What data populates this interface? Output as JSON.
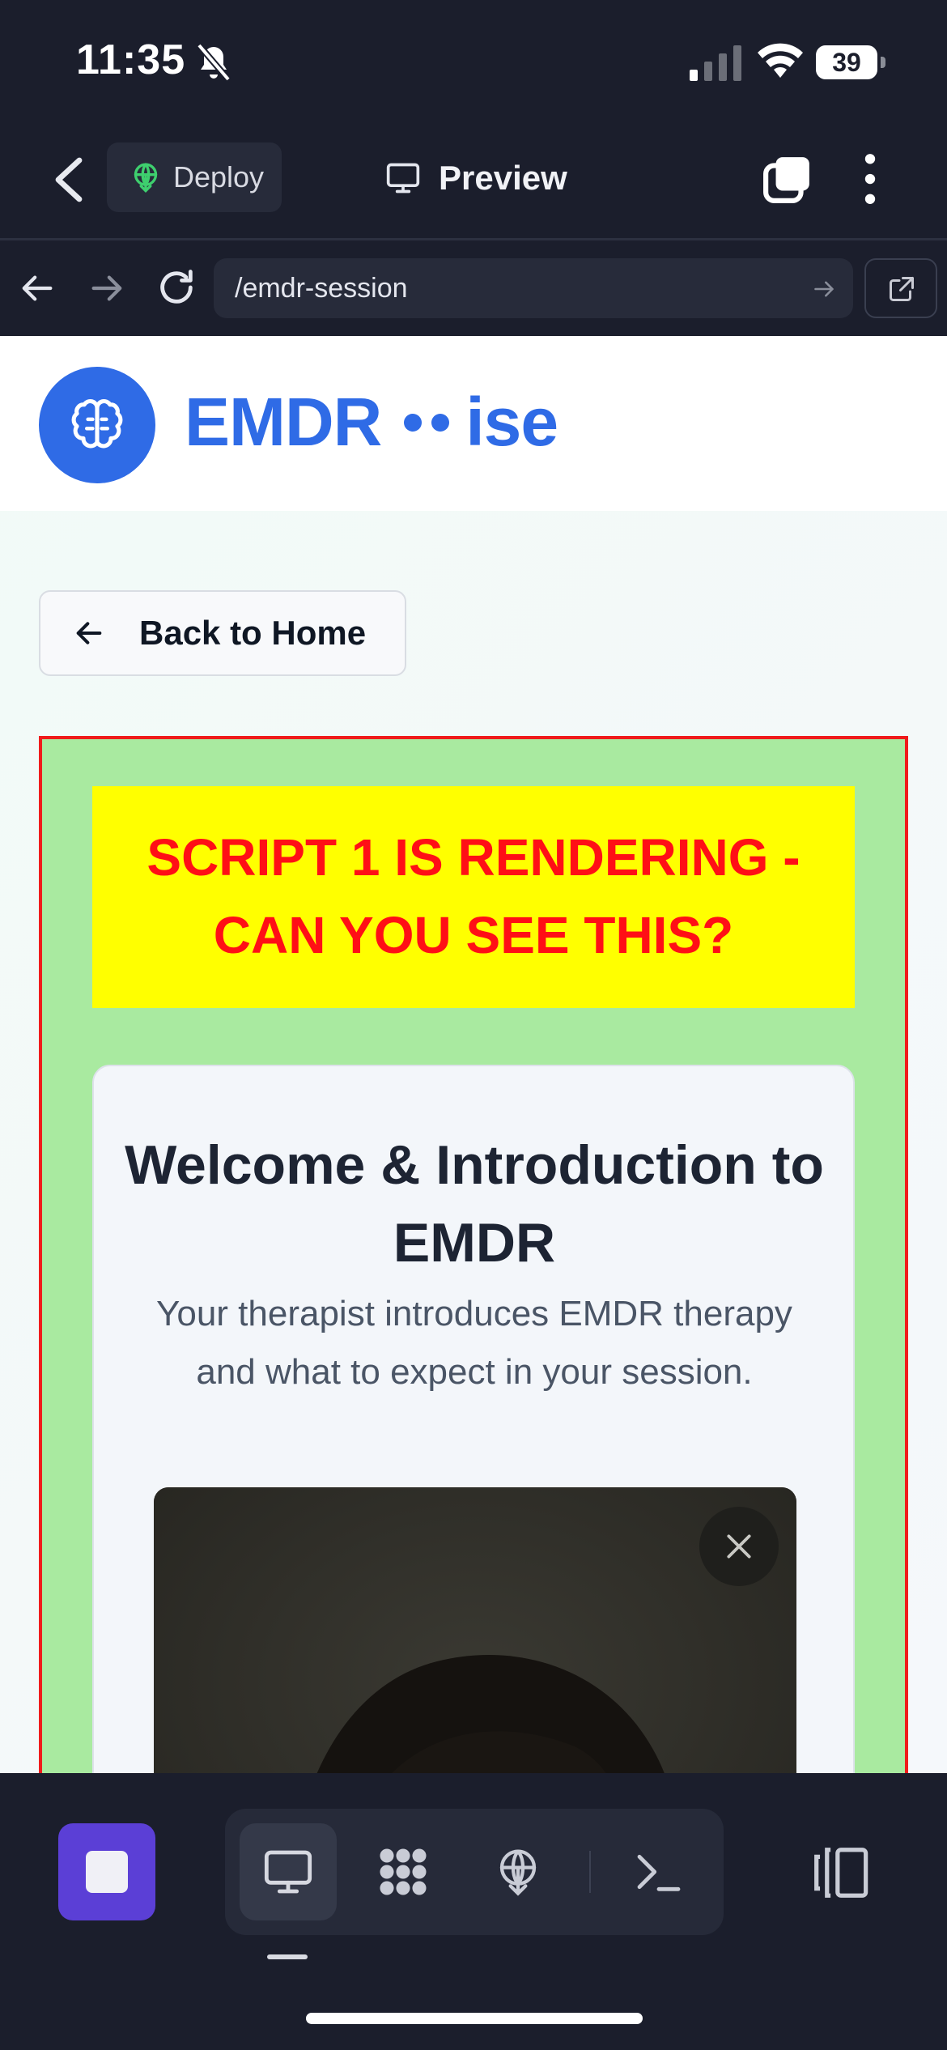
{
  "status_bar": {
    "time": "11:35",
    "battery": "39",
    "icons": [
      "bell-slash-icon",
      "cellular-signal-icon",
      "wifi-icon",
      "battery-icon"
    ]
  },
  "app_header": {
    "deploy_label": "Deploy",
    "preview_label": "Preview",
    "icons": [
      "chevron-left-icon",
      "deploy-icon",
      "monitor-icon",
      "tabs-icon",
      "more-vertical-icon"
    ]
  },
  "browser": {
    "url": "/emdr-session",
    "icons": [
      "arrow-left-icon",
      "arrow-right-icon",
      "reload-icon",
      "go-arrow-icon",
      "open-external-icon"
    ]
  },
  "site": {
    "brand_left": "EMDR",
    "brand_right": "ise",
    "logo_icon": "brain-icon",
    "back_button": "Back to Home",
    "debug_banner": "SCRIPT 1 IS RENDERING - CAN YOU SEE THIS?",
    "card": {
      "title": "Welcome & Introduction to EMDR",
      "description": "Your therapist introduces EMDR therapy and what to expect in your session."
    }
  },
  "toolbar": {
    "items": [
      "stop-icon",
      "monitor-icon",
      "grid-icon",
      "deploy-icon",
      "terminal-icon",
      "layout-icon"
    ],
    "active": "monitor-icon"
  },
  "colors": {
    "app_bg": "#1b1e2c",
    "brand_blue": "#2f6be6",
    "debug_yellow": "#ffff00",
    "debug_red": "#ff0f16",
    "box_green": "#a9eaa0",
    "stop_purple": "#5b3fd6"
  }
}
